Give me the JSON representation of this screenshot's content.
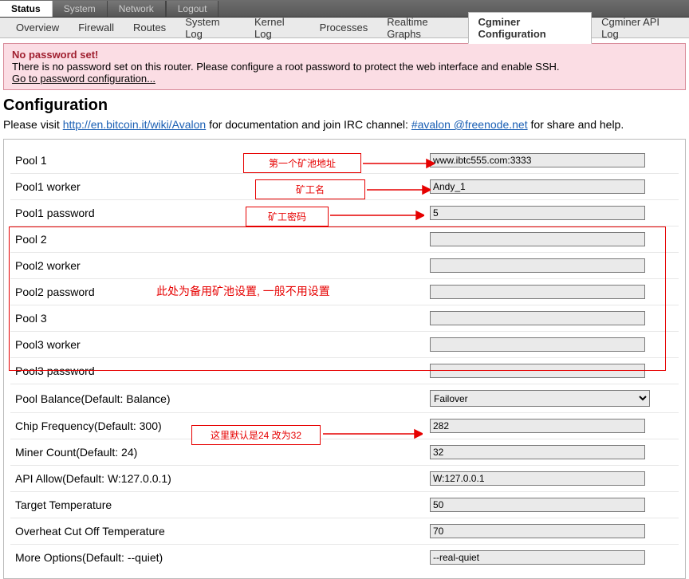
{
  "tabs": {
    "status": "Status",
    "system": "System",
    "network": "Network",
    "logout": "Logout"
  },
  "subtabs": {
    "overview": "Overview",
    "firewall": "Firewall",
    "routes": "Routes",
    "systemlog": "System Log",
    "kernellog": "Kernel Log",
    "processes": "Processes",
    "realtime": "Realtime Graphs",
    "cgminer": "Cgminer Configuration",
    "apilog": "Cgminer API Log"
  },
  "alert": {
    "title": "No password set!",
    "body": "There is no password set on this router. Please configure a root password to protect the web interface and enable SSH.",
    "link": "Go to password configuration..."
  },
  "section": {
    "title": "Configuration",
    "help_pre": "Please visit ",
    "help_link1": "http://en.bitcoin.it/wiki/Avalon",
    "help_mid": " for documentation and join IRC channel: ",
    "help_link2": "#avalon @freenode.net",
    "help_post": " for share and help."
  },
  "fields": {
    "pool1": {
      "label": "Pool 1",
      "value": "www.ibtc555.com:3333"
    },
    "pool1worker": {
      "label": "Pool1 worker",
      "value": "Andy_1"
    },
    "pool1pass": {
      "label": "Pool1 password",
      "value": "5"
    },
    "pool2": {
      "label": "Pool 2",
      "value": ""
    },
    "pool2worker": {
      "label": "Pool2 worker",
      "value": ""
    },
    "pool2pass": {
      "label": "Pool2 password",
      "value": ""
    },
    "pool3": {
      "label": "Pool 3",
      "value": ""
    },
    "pool3worker": {
      "label": "Pool3 worker",
      "value": ""
    },
    "pool3pass": {
      "label": "Pool3 password",
      "value": ""
    },
    "balance": {
      "label": "Pool Balance(Default: Balance)",
      "value": "Failover"
    },
    "chipfreq": {
      "label": "Chip Frequency(Default: 300)",
      "value": "282"
    },
    "minercount": {
      "label": "Miner Count(Default: 24)",
      "value": "32"
    },
    "apiallow": {
      "label": "API Allow(Default: W:127.0.0.1)",
      "value": "W:127.0.0.1"
    },
    "targettemp": {
      "label": "Target Temperature",
      "value": "50"
    },
    "overheat": {
      "label": "Overheat Cut Off Temperature",
      "value": "70"
    },
    "moreopts": {
      "label": "More Options(Default: --quiet)",
      "value": "--real-quiet"
    }
  },
  "annotations": {
    "ann1": "第一个矿池地址",
    "ann2": "矿工名",
    "ann3": "矿工密码",
    "ann4": "此处为备用矿池设置, 一般不用设置",
    "ann5": "这里默认是24 改为32"
  }
}
